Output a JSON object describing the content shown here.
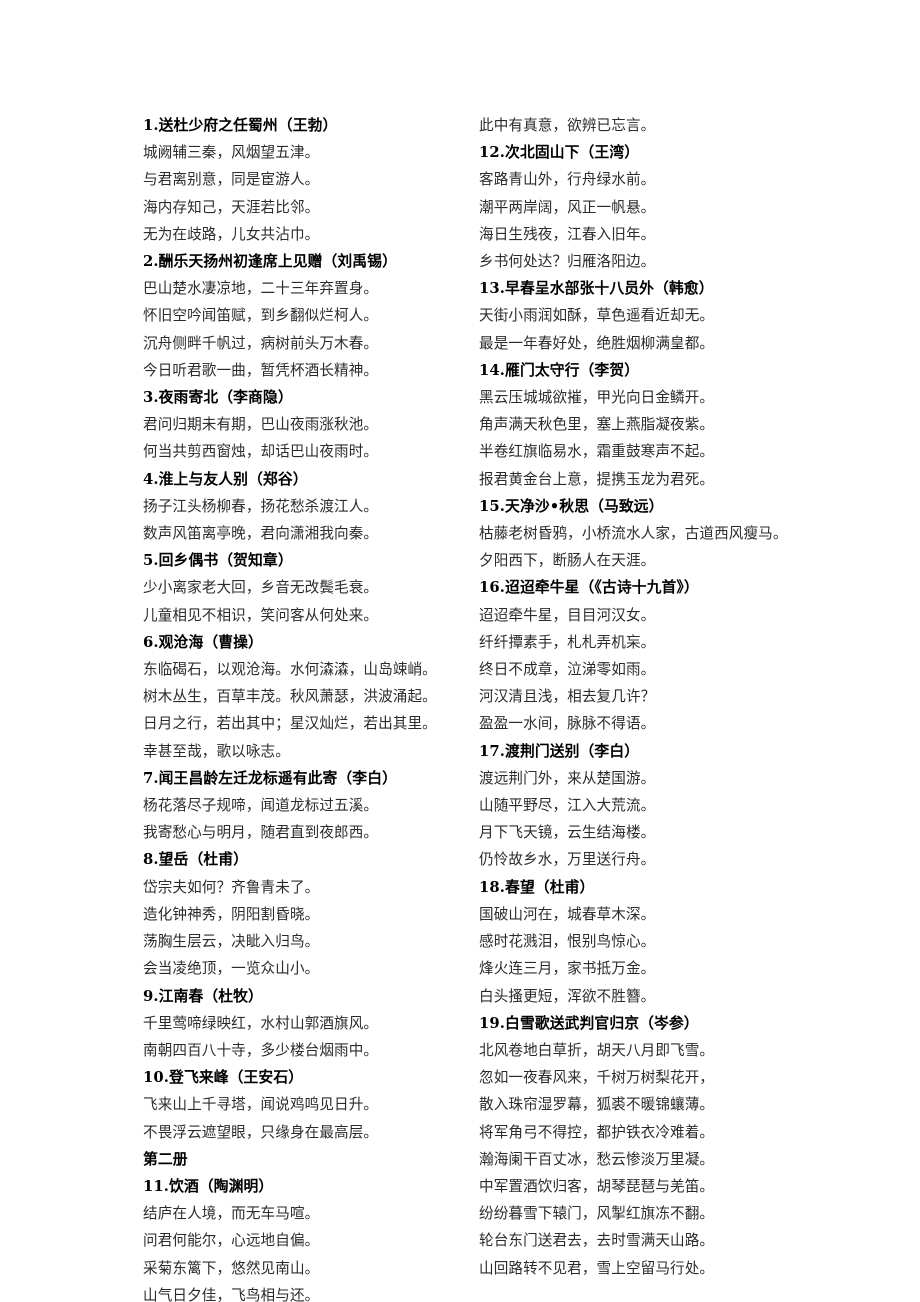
{
  "document": {
    "title": "古诗词背诵篇目",
    "text_color": "#222222",
    "background_color": "#ffffff"
  },
  "left_column": [
    {
      "kind": "heading",
      "text": "1.送杜少府之任蜀州（王勃）"
    },
    {
      "kind": "verse",
      "text": "城阙辅三秦，风烟望五津。"
    },
    {
      "kind": "verse",
      "text": "与君离别意，同是宦游人。"
    },
    {
      "kind": "verse",
      "text": "海内存知己，天涯若比邻。"
    },
    {
      "kind": "verse",
      "text": "无为在歧路，儿女共沾巾。"
    },
    {
      "kind": "heading",
      "text": "2.酬乐天扬州初逢席上见赠（刘禹锡）"
    },
    {
      "kind": "verse",
      "text": "巴山楚水凄凉地，二十三年弃置身。"
    },
    {
      "kind": "verse",
      "text": "怀旧空吟闻笛赋，到乡翻似烂柯人。"
    },
    {
      "kind": "verse",
      "text": "沉舟侧畔千帆过，病树前头万木春。"
    },
    {
      "kind": "verse",
      "text": "今日听君歌一曲，暂凭杯酒长精神。"
    },
    {
      "kind": "heading",
      "text": "3.夜雨寄北（李商隐）"
    },
    {
      "kind": "verse",
      "text": "君问归期未有期，巴山夜雨涨秋池。"
    },
    {
      "kind": "verse",
      "text": "何当共剪西窗烛，却话巴山夜雨时。"
    },
    {
      "kind": "heading",
      "text": "4.淮上与友人别（郑谷）"
    },
    {
      "kind": "verse",
      "text": "扬子江头杨柳春，扬花愁杀渡江人。"
    },
    {
      "kind": "verse",
      "text": "数声风笛离亭晚，君向潇湘我向秦。"
    },
    {
      "kind": "heading",
      "text": "5.回乡偶书（贺知章）"
    },
    {
      "kind": "verse",
      "text": "少小离家老大回，乡音无改鬓毛衰。"
    },
    {
      "kind": "verse",
      "text": "儿童相见不相识，笑问客从何处来。"
    },
    {
      "kind": "heading",
      "text": "6.观沧海（曹操）"
    },
    {
      "kind": "verse",
      "text": "东临碣石，以观沧海。水何潹潹，山岛竦峭。"
    },
    {
      "kind": "verse",
      "text": "树木丛生，百草丰茂。秋风萧瑟，洪波涌起。"
    },
    {
      "kind": "verse",
      "text": "日月之行，若出其中；星汉灿烂，若出其里。"
    },
    {
      "kind": "verse",
      "text": "幸甚至哉，歌以咏志。"
    },
    {
      "kind": "heading",
      "text": "7.闻王昌龄左迁龙标遥有此寄（李白）"
    },
    {
      "kind": "verse",
      "text": "杨花落尽子规啼，闻道龙标过五溪。"
    },
    {
      "kind": "verse",
      "text": "我寄愁心与明月，随君直到夜郎西。"
    },
    {
      "kind": "heading",
      "text": "8.望岳（杜甫）"
    },
    {
      "kind": "verse",
      "text": "岱宗夫如何？齐鲁青未了。"
    },
    {
      "kind": "verse",
      "text": "造化钟神秀，阴阳割昏晓。"
    },
    {
      "kind": "verse",
      "text": "荡胸生层云，决眦入归鸟。"
    },
    {
      "kind": "verse",
      "text": "会当凌绝顶，一览众山小。"
    },
    {
      "kind": "heading",
      "text": "9.江南春（杜牧）"
    },
    {
      "kind": "verse",
      "text": "千里莺啼绿映红，水村山郭酒旗风。"
    },
    {
      "kind": "verse",
      "text": "南朝四百八十寺，多少楼台烟雨中。"
    },
    {
      "kind": "heading",
      "text": "10.登飞来峰（王安石）"
    },
    {
      "kind": "verse",
      "text": "飞来山上千寻塔，闻说鸡鸣见日升。"
    },
    {
      "kind": "verse",
      "text": "不畏浮云遮望眼，只缘身在最高层。"
    },
    {
      "kind": "heading",
      "text": "第二册"
    },
    {
      "kind": "heading",
      "text": "11.饮酒（陶渊明）"
    },
    {
      "kind": "verse",
      "text": "结庐在人境，而无车马喧。"
    },
    {
      "kind": "verse",
      "text": "问君何能尔，心远地自偏。"
    },
    {
      "kind": "verse",
      "text": "采菊东篱下，悠然见南山。"
    },
    {
      "kind": "verse",
      "text": "山气日夕佳，飞鸟相与还。"
    }
  ],
  "right_column": [
    {
      "kind": "verse",
      "text": "此中有真意，欲辨已忘言。"
    },
    {
      "kind": "heading",
      "text": "12.次北固山下（王湾）"
    },
    {
      "kind": "verse",
      "text": "客路青山外，行舟绿水前。"
    },
    {
      "kind": "verse",
      "text": "潮平两岸阔，风正一帆悬。"
    },
    {
      "kind": "verse",
      "text": "海日生残夜，江春入旧年。"
    },
    {
      "kind": "verse",
      "text": "乡书何处达？归雁洛阳边。"
    },
    {
      "kind": "heading",
      "text": "13.早春呈水部张十八员外（韩愈）"
    },
    {
      "kind": "verse",
      "text": "天街小雨润如酥，草色遥看近却无。"
    },
    {
      "kind": "verse",
      "text": "最是一年春好处，绝胜烟柳满皇都。"
    },
    {
      "kind": "heading",
      "text": "14.雁门太守行（李贺）"
    },
    {
      "kind": "verse",
      "text": "黑云压城城欲摧，甲光向日金鳞开。"
    },
    {
      "kind": "verse",
      "text": "角声满天秋色里，塞上燕脂凝夜紫。"
    },
    {
      "kind": "verse",
      "text": "半卷红旗临易水，霜重鼓寒声不起。"
    },
    {
      "kind": "verse",
      "text": "报君黄金台上意，提携玉龙为君死。"
    },
    {
      "kind": "heading",
      "text": "15.天净沙•秋思（马致远）"
    },
    {
      "kind": "verse",
      "text": "枯藤老树昏鸦，小桥流水人家，古道西风瘦马。"
    },
    {
      "kind": "verse",
      "text": "夕阳西下，断肠人在天涯。"
    },
    {
      "kind": "heading",
      "text": "16.迢迢牵牛星（《古诗十九首》）"
    },
    {
      "kind": "verse",
      "text": "迢迢牵牛星，目目河汉女。"
    },
    {
      "kind": "verse",
      "text": "纤纤撢素手，札札弄机杗。"
    },
    {
      "kind": "verse",
      "text": "终日不成章，泣涕零如雨。"
    },
    {
      "kind": "verse",
      "text": "河汉清且浅，相去复几许？"
    },
    {
      "kind": "verse",
      "text": "盈盈一水间，脉脉不得语。"
    },
    {
      "kind": "heading",
      "text": "17.渡荆门送别（李白）"
    },
    {
      "kind": "verse",
      "text": "渡远荆门外，来从楚国游。"
    },
    {
      "kind": "verse",
      "text": "山随平野尽，江入大荒流。"
    },
    {
      "kind": "verse",
      "text": "月下飞天镜，云生结海楼。"
    },
    {
      "kind": "verse",
      "text": "仍怜故乡水，万里送行舟。"
    },
    {
      "kind": "heading",
      "text": "18.春望（杜甫）"
    },
    {
      "kind": "verse",
      "text": "国破山河在，城春草木深。"
    },
    {
      "kind": "verse",
      "text": "感时花溅泪，恨别鸟惊心。"
    },
    {
      "kind": "verse",
      "text": "烽火连三月，家书抵万金。"
    },
    {
      "kind": "verse",
      "text": "白头搔更短，浑欲不胜簪。"
    },
    {
      "kind": "heading",
      "text": "19.白雪歌送武判官归京（岑参）"
    },
    {
      "kind": "verse",
      "text": "北风卷地白草折，胡天八月即飞雪。"
    },
    {
      "kind": "verse",
      "text": "忽如一夜春风来，千树万树梨花开，"
    },
    {
      "kind": "verse",
      "text": "散入珠帘湿罗幕，狐裘不暖锦蠰薄。"
    },
    {
      "kind": "verse",
      "text": "将军角弓不得控，都护铁衣冷难着。"
    },
    {
      "kind": "verse",
      "text": "瀚海阑干百丈冰，愁云惨淡万里凝。"
    },
    {
      "kind": "verse",
      "text": "中军置酒饮归客，胡琴琵琶与羌笛。"
    },
    {
      "kind": "verse",
      "text": "纷纷暮雪下辕门，风掣红旗冻不翻。"
    },
    {
      "kind": "verse",
      "text": "轮台东门送君去，去时雪满天山路。"
    },
    {
      "kind": "verse",
      "text": "山回路转不见君，雪上空留马行处。"
    }
  ]
}
